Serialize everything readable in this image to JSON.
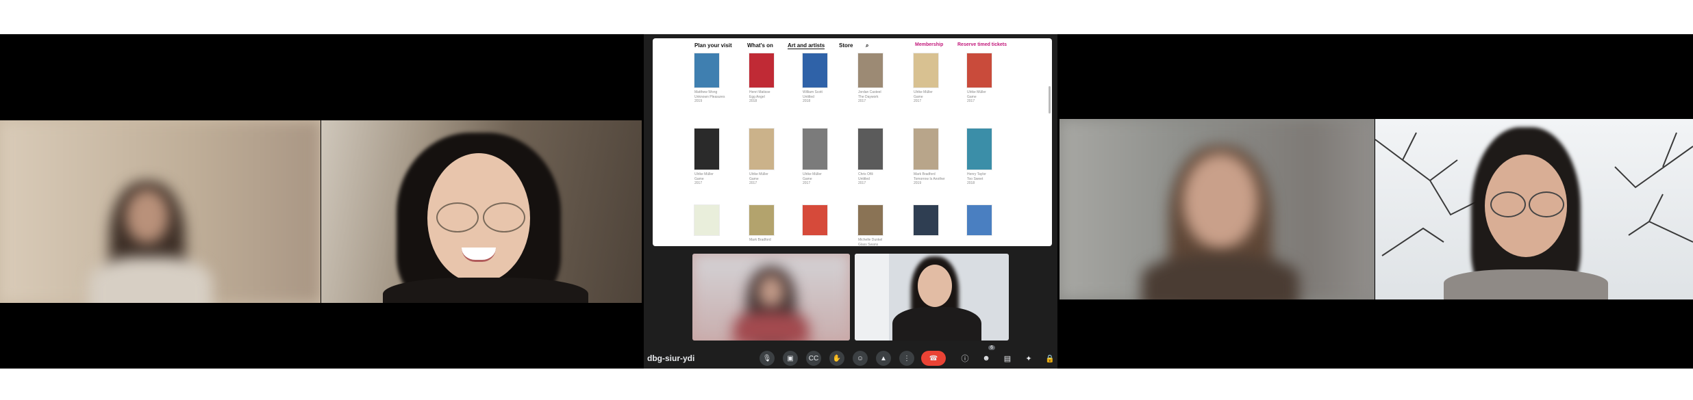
{
  "meeting": {
    "code": "dbg-siur-ydi"
  },
  "website": {
    "nav": [
      "Plan your visit",
      "What's on",
      "Art and artists",
      "Store"
    ],
    "membership": "Membership",
    "tickets": "Reserve timed tickets"
  },
  "artworks": [
    {
      "artist": "Matthew Wong",
      "title": "Unknown Pleasures",
      "year": "2019",
      "color": "#3f7fb0"
    },
    {
      "artist": "Henri Matisse",
      "title": "Egg Angel",
      "year": "2018",
      "color": "#c02a35"
    },
    {
      "artist": "William Scott",
      "title": "Untitled",
      "year": "2018",
      "color": "#2f62a8"
    },
    {
      "artist": "Jordan Casteel",
      "title": "The Daywork",
      "year": "2017",
      "color": "#9c8a74"
    },
    {
      "artist": "Ulrike Müller",
      "title": "Game",
      "year": "2017",
      "color": "#d8c191"
    },
    {
      "artist": "Ulrike Müller",
      "title": "Game",
      "year": "2017",
      "color": "#c94b3b"
    },
    {
      "artist": "Ulrike Müller",
      "title": "Game",
      "year": "2017",
      "color": "#2a2a2a"
    },
    {
      "artist": "Ulrike Müller",
      "title": "Game",
      "year": "2017",
      "color": "#cbb28a"
    },
    {
      "artist": "Ulrike Müller",
      "title": "Game",
      "year": "2017",
      "color": "#7b7b7b"
    },
    {
      "artist": "Chris Ofili",
      "title": "Untitled",
      "year": "2017",
      "color": "#5b5b5b"
    },
    {
      "artist": "Mark Bradford",
      "title": "Tomorrow Is Another",
      "year": "2019",
      "color": "#b8a58a"
    },
    {
      "artist": "Henry Taylor",
      "title": "Too Sweet",
      "year": "2018",
      "color": "#3b8ea8"
    },
    {
      "artist": "",
      "title": "",
      "year": "",
      "color": "#e9eedb"
    },
    {
      "artist": "Mark Bradford",
      "title": "",
      "year": "",
      "color": "#b3a36d"
    },
    {
      "artist": "",
      "title": "",
      "year": "",
      "color": "#d64a3a"
    },
    {
      "artist": "Michelle Dunkel",
      "title": "Glass Swans",
      "year": "",
      "color": "#8a7355"
    },
    {
      "artist": "",
      "title": "",
      "year": "",
      "color": "#2f3e52"
    },
    {
      "artist": "",
      "title": "",
      "year": "",
      "color": "#4a7fc1"
    }
  ],
  "controls": {
    "mic": "mic-icon",
    "camera": "camera-icon",
    "captions": "captions-icon",
    "raise_hand": "hand-icon",
    "emoji": "emoji-icon",
    "present": "present-icon",
    "more": "more-icon",
    "leave": "end-call-icon",
    "info": "info-icon",
    "people": "people-icon",
    "chat": "chat-icon",
    "activities": "activities-icon",
    "host": "host-controls-icon",
    "people_count": "6"
  }
}
